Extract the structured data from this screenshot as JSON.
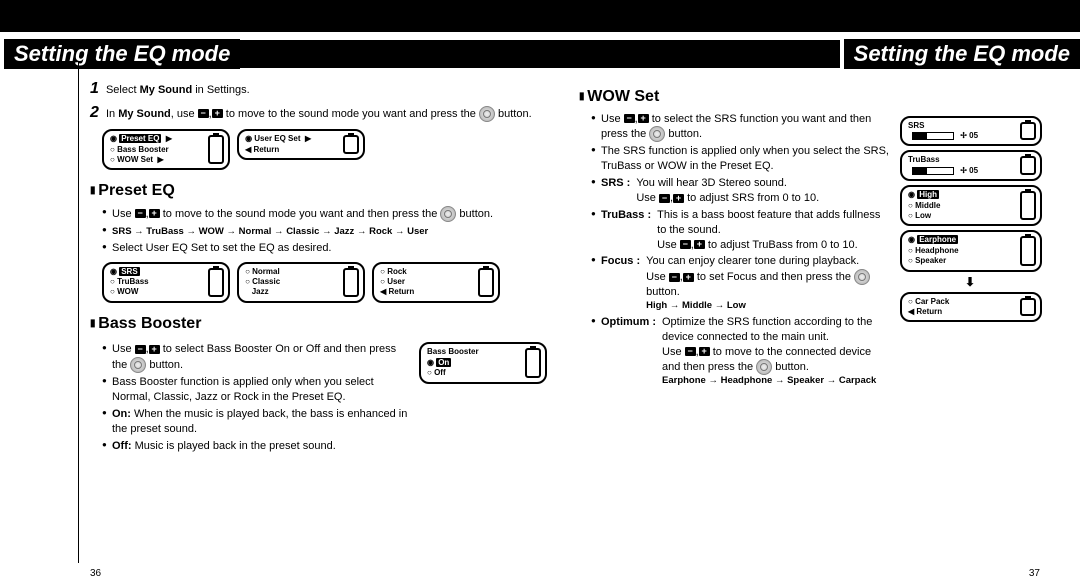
{
  "title_left": "Setting the EQ mode",
  "title_right": "Setting the EQ mode",
  "left": {
    "step1": {
      "n": "1",
      "text_a": "Select ",
      "bold": "My Sound",
      "text_b": " in Settings."
    },
    "step2": {
      "n": "2",
      "text_a": "In ",
      "bold": "My Sound",
      "text_b": ", use ",
      "text_c": " to move to the sound mode you want and press the ",
      "text_d": " button."
    },
    "screens_top": {
      "a": [
        "Preset EQ",
        "Bass Booster",
        "WOW Set"
      ],
      "b": [
        "User EQ Set",
        "Return"
      ]
    },
    "preset": {
      "heading": "Preset EQ",
      "b1a": "Use ",
      "b1b": " to move to the sound mode you want and then press the ",
      "b1c": " button.",
      "seq": "SRS → TruBass → WOW → Normal → Classic → Jazz → Rock → User",
      "b2": "Select User EQ Set to set the EQ as desired.",
      "screens": {
        "a": [
          "SRS",
          "TruBass",
          "WOW"
        ],
        "b": [
          "Normal",
          "Classic",
          "Jazz"
        ],
        "c": [
          "Rock",
          "User",
          "Return"
        ]
      }
    },
    "bass": {
      "heading": "Bass Booster",
      "b1a": "Use ",
      "b1b": " to select Bass Booster On or Off and then press the ",
      "b1c": " button.",
      "b2": "Bass Booster function is applied only when you select Normal, Classic, Jazz or Rock in the Preset EQ.",
      "b3": {
        "t": "On:",
        "d": "When the music is played back, the bass is enhanced in the preset sound."
      },
      "b4": {
        "t": "Off:",
        "d": "Music is played back in the preset sound."
      },
      "screen": [
        "Bass Booster",
        "On",
        "Off"
      ]
    },
    "page": "36"
  },
  "right": {
    "heading": "WOW Set",
    "b1a": "Use ",
    "b1b": " to select the SRS function you want and then press the ",
    "b1c": " button.",
    "b2": "The SRS function is applied only when you select the SRS, TruBass or WOW in the Preset EQ.",
    "defs": {
      "srs": {
        "t": "SRS :",
        "d1": "You will hear 3D Stereo sound.",
        "d2a": "Use ",
        "d2b": " to adjust SRS from 0 to 10."
      },
      "trubass": {
        "t": "TruBass :",
        "d1": "This is a bass boost feature that adds fullness to the sound.",
        "d2a": "Use ",
        "d2b": " to adjust TruBass from 0 to 10."
      },
      "focus": {
        "t": "Focus :",
        "d1": "You can enjoy clearer tone during playback.",
        "d2a": "Use ",
        "d2b": " to set Focus and then press the ",
        "d2c": " button.",
        "seq": "High → Middle → Low"
      },
      "optimum": {
        "t": "Optimum :",
        "d1": "Optimize the SRS function according to the device connected to the main unit.",
        "d2a": "Use ",
        "d2b": " to move  to the connected device and then press the ",
        "d2c": " button.",
        "seq": "Earphone → Headphone → Speaker → Carpack"
      }
    },
    "screens": {
      "srs": {
        "title": "SRS",
        "val": "05"
      },
      "trubass": {
        "title": "TruBass",
        "val": "05"
      },
      "focus": [
        "High",
        "Middle",
        "Low"
      ],
      "opt1": [
        "Earphone",
        "Headphone",
        "Speaker"
      ],
      "opt2": [
        "Car Pack",
        "Return"
      ]
    },
    "page": "37"
  }
}
